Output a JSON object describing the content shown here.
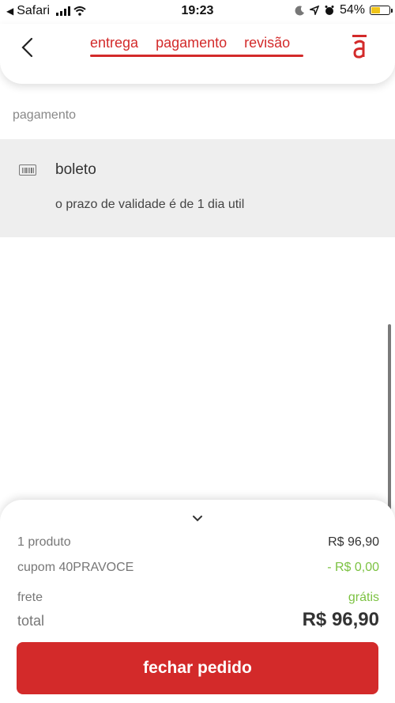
{
  "status": {
    "carrier": "Safari",
    "time": "19:23",
    "battery_percent": "54%",
    "battery_level": 0.54
  },
  "header": {
    "back_icon": "chevron-left-icon",
    "steps": [
      "entrega",
      "pagamento",
      "revisão"
    ],
    "logo": "americanas-logo"
  },
  "payment": {
    "section_title": "pagamento",
    "method_icon": "barcode-icon",
    "method_name": "boleto",
    "method_description": "o prazo de validade é de 1 dia util"
  },
  "summary": {
    "rows": [
      {
        "label": "1 produto",
        "value": "R$ 96,90"
      },
      {
        "label": "cupom 40PRAVOCE",
        "value": "- R$ 0,00"
      },
      {
        "label": "frete",
        "value": "grátis"
      }
    ],
    "total_label": "total",
    "total_value": "R$ 96,90",
    "button_label": "fechar pedido"
  },
  "colors": {
    "accent": "#d32a2a",
    "discount_green": "#7cc242",
    "panel_gray": "#eeeeee"
  }
}
